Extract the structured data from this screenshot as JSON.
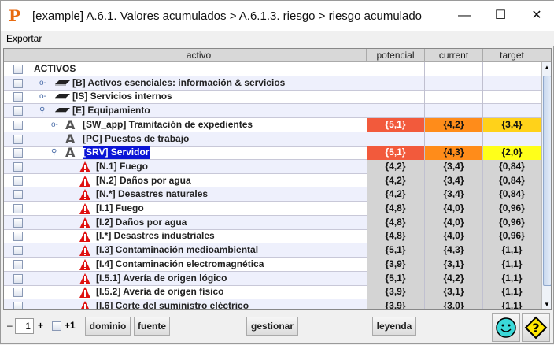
{
  "window": {
    "title": "[example] A.6.1. Valores acumulados > A.6.1.3. riesgo > riesgo acumulado",
    "logo": "P"
  },
  "menu": {
    "export": "Exportar"
  },
  "columns": [
    "activo",
    "potencial",
    "current",
    "target"
  ],
  "rows": [
    {
      "name": "ACTIVOS",
      "level": 0,
      "icon": "none",
      "toggle": "none",
      "pot": "",
      "cur": "",
      "tgt": ""
    },
    {
      "name": "[B] Activos esenciales: información & servicios",
      "level": 1,
      "icon": "layer",
      "toggle": "collapsed",
      "pot": "",
      "cur": "",
      "tgt": ""
    },
    {
      "name": "[IS] Servicios internos",
      "level": 1,
      "icon": "layer",
      "toggle": "collapsed",
      "pot": "",
      "cur": "",
      "tgt": ""
    },
    {
      "name": "[E] Equipamiento",
      "level": 1,
      "icon": "layer",
      "toggle": "expanded",
      "pot": "",
      "cur": "",
      "tgt": ""
    },
    {
      "name": "[SW_app] Tramitación de expedientes",
      "level": 2,
      "icon": "asset",
      "toggle": "collapsed",
      "pot": "{5,1}",
      "cur": "{4,2}",
      "tgt": "{3,4}",
      "colors": [
        "#f25a3c",
        "#ff8c1a",
        "#ffd21a"
      ]
    },
    {
      "name": "[PC] Puestos de trabajo",
      "level": 2,
      "icon": "asset",
      "toggle": "none",
      "pot": "",
      "cur": "",
      "tgt": ""
    },
    {
      "name": "[SRV] Servidor",
      "level": 2,
      "icon": "asset",
      "toggle": "expanded",
      "selected": true,
      "pot": "{5,1}",
      "cur": "{4,3}",
      "tgt": "{2,0}",
      "colors": [
        "#f25a3c",
        "#ff8c1a",
        "#ffff1a"
      ]
    },
    {
      "name": "[N.1] Fuego",
      "level": 3,
      "icon": "threat",
      "pot": "{4,2}",
      "cur": "{3,4}",
      "tgt": "{0,84}"
    },
    {
      "name": "[N.2] Daños por agua",
      "level": 3,
      "icon": "threat",
      "pot": "{4,2}",
      "cur": "{3,4}",
      "tgt": "{0,84}"
    },
    {
      "name": "[N.*] Desastres naturales",
      "level": 3,
      "icon": "threat",
      "pot": "{4,2}",
      "cur": "{3,4}",
      "tgt": "{0,84}"
    },
    {
      "name": "[I.1] Fuego",
      "level": 3,
      "icon": "threat",
      "pot": "{4,8}",
      "cur": "{4,0}",
      "tgt": "{0,96}"
    },
    {
      "name": "[I.2] Daños por agua",
      "level": 3,
      "icon": "threat",
      "pot": "{4,8}",
      "cur": "{4,0}",
      "tgt": "{0,96}"
    },
    {
      "name": "[I.*] Desastres industriales",
      "level": 3,
      "icon": "threat",
      "pot": "{4,8}",
      "cur": "{4,0}",
      "tgt": "{0,96}"
    },
    {
      "name": "[I.3] Contaminación medioambiental",
      "level": 3,
      "icon": "threat",
      "pot": "{5,1}",
      "cur": "{4,3}",
      "tgt": "{1,1}"
    },
    {
      "name": "[I.4] Contaminación electromagnética",
      "level": 3,
      "icon": "threat",
      "pot": "{3,9}",
      "cur": "{3,1}",
      "tgt": "{1,1}"
    },
    {
      "name": "[I.5.1] Avería de origen lógico",
      "level": 3,
      "icon": "threat",
      "pot": "{5,1}",
      "cur": "{4,2}",
      "tgt": "{1,1}"
    },
    {
      "name": "[I.5.2] Avería de origen físico",
      "level": 3,
      "icon": "threat",
      "pot": "{3,9}",
      "cur": "{3,1}",
      "tgt": "{1,1}"
    },
    {
      "name": "[I.6] Corte del suministro eléctrico",
      "level": 3,
      "icon": "threat",
      "pot": "{3,9}",
      "cur": "{3,0}",
      "tgt": "{1,1}"
    }
  ],
  "footer": {
    "minus": "–",
    "level": "1",
    "plus": "+",
    "plus_one": "+1",
    "domain": "dominio",
    "source": "fuente",
    "manage": "gestionar",
    "legend": "leyenda"
  }
}
